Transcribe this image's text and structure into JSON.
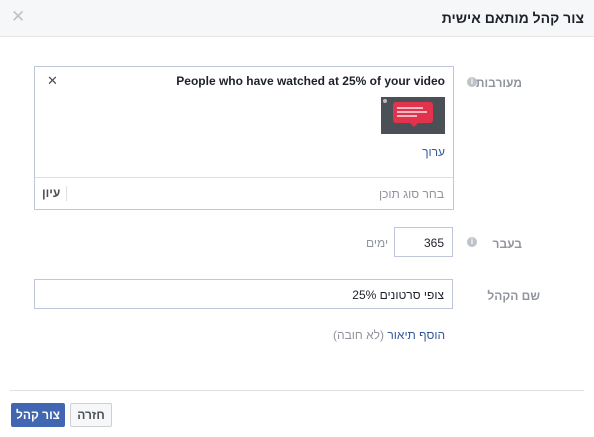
{
  "dialog": {
    "title": "צור קהל מותאם אישית",
    "close_icon": "close-icon"
  },
  "engagement": {
    "label": "מעורבות",
    "audience_name": "People who have watched at 25% of your video",
    "edit_link": "ערוך",
    "search_placeholder": "בחר סוג תוכן",
    "browse_button": "עיון"
  },
  "retention": {
    "label": "בעבר",
    "days_value": "365",
    "days_unit": "ימים"
  },
  "audience_name": {
    "label": "שם הקהל",
    "value": "צופי סרטונים 25%"
  },
  "description": {
    "link": "הוסף תיאור",
    "optional": "(לא חובה)"
  },
  "footer": {
    "create_button": "צור קהל",
    "back_button": "חזרה"
  },
  "colors": {
    "primary": "#4267b2",
    "link": "#365899",
    "thumbnail_accent": "#e2334c"
  }
}
